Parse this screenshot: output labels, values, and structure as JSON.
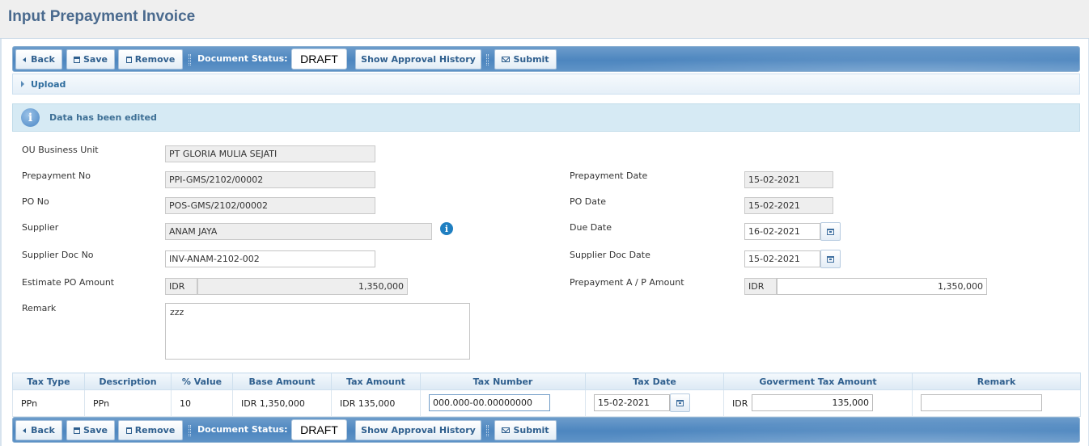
{
  "page": {
    "title": "Input Prepayment Invoice"
  },
  "toolbar": {
    "back_label": "Back",
    "save_label": "Save",
    "remove_label": "Remove",
    "doc_status_label": "Document Status:",
    "doc_status_value": "DRAFT",
    "approval_label": "Show Approval History",
    "submit_label": "Submit"
  },
  "upload": {
    "label": "Upload"
  },
  "notice": {
    "text": "Data has been edited",
    "icon": "info-icon"
  },
  "form": {
    "ou_label": "OU Business Unit",
    "ou_value": "PT GLORIA MULIA SEJATI",
    "prepayment_no_label": "Prepayment No",
    "prepayment_no_value": "PPI-GMS/2102/00002",
    "po_no_label": "PO No",
    "po_no_value": "POS-GMS/2102/00002",
    "supplier_label": "Supplier",
    "supplier_value": "ANAM JAYA",
    "supplier_doc_no_label": "Supplier Doc No",
    "supplier_doc_no_value": "INV-ANAM-2102-002",
    "estimate_label": "Estimate PO Amount",
    "estimate_currency": "IDR",
    "estimate_value": "1,350,000",
    "remark_label": "Remark",
    "remark_value": "zzz",
    "prepayment_date_label": "Prepayment Date",
    "prepayment_date_value": "15-02-2021",
    "po_date_label": "PO Date",
    "po_date_value": "15-02-2021",
    "due_date_label": "Due Date",
    "due_date_value": "16-02-2021",
    "supplier_doc_date_label": "Supplier Doc Date",
    "supplier_doc_date_value": "15-02-2021",
    "ap_amount_label": "Prepayment A / P Amount",
    "ap_currency": "IDR",
    "ap_value": "1,350,000"
  },
  "tax_table": {
    "headers": [
      "Tax Type",
      "Description",
      "% Value",
      "Base Amount",
      "Tax Amount",
      "Tax Number",
      "Tax Date",
      "Goverment Tax Amount",
      "Remark"
    ],
    "rows": [
      {
        "tax_type": "PPn",
        "description": "PPn",
        "percent": "10",
        "base_amount": "IDR 1,350,000",
        "tax_amount": "IDR 135,000",
        "tax_number": "000.000-00.00000000",
        "tax_date": "15-02-2021",
        "gov_currency": "IDR",
        "gov_amount": "135,000",
        "remark": ""
      }
    ]
  }
}
